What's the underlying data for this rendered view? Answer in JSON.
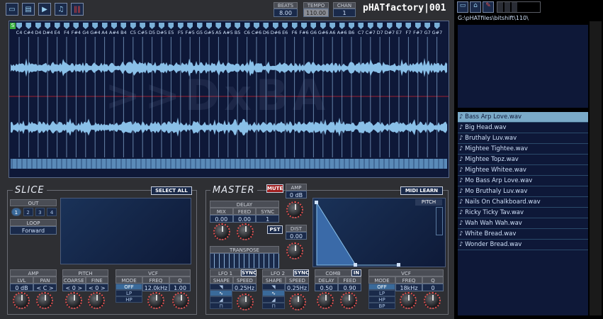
{
  "header": {
    "beats_label": "BEATS",
    "beats_value": "8.00",
    "tempo_label": "TEMPO",
    "tempo_value": "110.00",
    "chan_label": "CHAN",
    "chan_value": "1",
    "app_title": "pHATfactory|001"
  },
  "slice_markers": [
    "C4",
    "C#4",
    "D4",
    "D#4",
    "E4",
    "F4",
    "F#4",
    "G4",
    "G#4",
    "A4",
    "A#4",
    "B4",
    "C5",
    "C#5",
    "D5",
    "D#5",
    "E5",
    "F5",
    "F#5",
    "G5",
    "G#5",
    "A5",
    "A#5",
    "B5",
    "C6",
    "C#6",
    "D6",
    "D#6",
    "E6",
    "F6",
    "F#6",
    "G6",
    "G#6",
    "A6",
    "A#6",
    "B6",
    "C7",
    "C#7",
    "D7",
    "D#7",
    "E7",
    "F7",
    "F#7",
    "G7",
    "G#7"
  ],
  "marker_s": "S",
  "watermark": ">>DxBA",
  "slice": {
    "title": "SLICE",
    "select_all": "SELECT ALL",
    "out_label": "OUT",
    "out_options": [
      "1",
      "2",
      "3",
      "4"
    ],
    "loop_label": "LOOP",
    "loop_value": "Forward",
    "amp_label": "AMP",
    "lvl_label": "LVL",
    "pan_label": "PAN",
    "lvl_value": "0 dB",
    "pan_value": "< C >",
    "pitch_label": "PITCH",
    "coarse_label": "COARSE",
    "fine_label": "FINE",
    "coarse_value": "< 0 >",
    "fine_value": "< 0 >",
    "vcf_label": "VCF",
    "mode_label": "MODE",
    "freq_label": "FREQ",
    "q_label": "Q",
    "mode_options": [
      "OFF",
      "LP",
      "HP"
    ],
    "freq_value": "12.0kHz",
    "q_value": "1.00"
  },
  "master": {
    "title": "MASTER",
    "mute": "MUTE",
    "amp_label": "AMP",
    "amp_value": "0 dB",
    "midi_learn": "MIDI LEARN",
    "delay_label": "DELAY",
    "mix_label": "MIX",
    "feed_label": "FEED",
    "sync_label": "SYNC",
    "mix_value": "0.00",
    "feed_value": "0.00",
    "sync_value": "1",
    "pst": "PST",
    "dist_label": "DIST",
    "dist_value": "0.00",
    "transpose_label": "TRANSPOSE",
    "pitch_env": "PITCH",
    "lfo1_label": "LFO 1",
    "lfo2_label": "LFO 2",
    "sync_btn": "SYNC",
    "shape_label": "SHAPE",
    "speed_label": "SPEED",
    "lfo1_speed": "0.25Hz",
    "lfo2_speed": "0.25Hz",
    "comb_label": "COMB",
    "comb_in": "IN",
    "comb_delay_label": "DELAY",
    "comb_feed_label": "FEED",
    "comb_delay": "0.50",
    "comb_feed": "0.90",
    "vcf_label": "VCF",
    "mode_label": "MODE",
    "freq_label": "FREQ",
    "q_label": "Q",
    "mode_options": [
      "OFF",
      "LP",
      "HP",
      "BP"
    ],
    "freq_value": "18kHz",
    "q_value": "0"
  },
  "browser": {
    "path": "G:\\pHATfiles\\bitshift\\110\\",
    "files": [
      "Bass Arp Love.wav",
      "Big Head.wav",
      "Bruthaly Luv.wav",
      "Mightee Tightee.wav",
      "Mightee Topz.wav",
      "Mightee Whitee.wav",
      "Mo Bass Arp Love.wav",
      "Mo Bruthaly Luv.wav",
      "Nails On Chalkboard.wav",
      "Ricky Ticky Tav.wav",
      "Wah Wah Wah.wav",
      "White Bread.wav",
      "Wonder Bread.wav"
    ],
    "selected_index": 0
  }
}
